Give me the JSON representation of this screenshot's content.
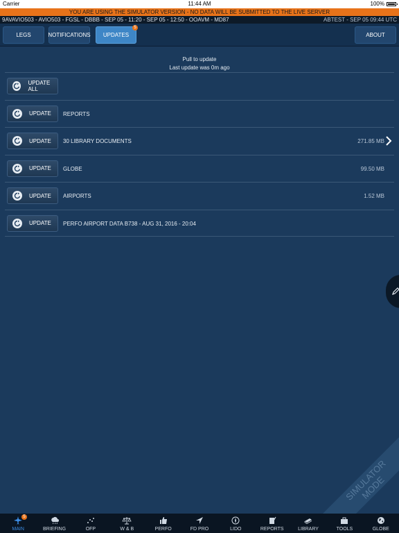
{
  "status_bar": {
    "carrier": "Carrier",
    "time": "11:44 AM",
    "battery": "100%"
  },
  "banner": "YOU ARE USING THE SIMULATOR VERSION - NO DATA WILL BE SUBMITTED TO THE LIVE SERVER",
  "flight_info": {
    "left": "9AVAVIO503 - AVIO503 - FGSL - DBBB - SEP 05 - 11:20 - SEP 05 - 12:50 - OOAVM - MD87",
    "right": "ABTEST - SEP 05 09:44 UTC"
  },
  "tabs": {
    "legs": "LEGS",
    "notifications": "NOTIFICATIONS",
    "updates": "UPDATES",
    "updates_badge": "5",
    "about": "ABOUT"
  },
  "pull": {
    "line1": "Pull to update",
    "line2": "Last update was 0m ago"
  },
  "update_all_label": "UPDATE ALL",
  "update_label": "UPDATE",
  "updates": [
    {
      "label": "REPORTS",
      "size": ""
    },
    {
      "label": "30 LIBRARY DOCUMENTS",
      "size": "271.85 MB"
    },
    {
      "label": "GLOBE",
      "size": "99.50 MB"
    },
    {
      "label": "AIRPORTS",
      "size": "1.52 MB"
    },
    {
      "label": "PERFO AIRPORT DATA B738 - AUG 31, 2016 - 20:04",
      "size": ""
    }
  ],
  "simulator_mode": {
    "line1": "SIMULATOR",
    "line2": "MODE"
  },
  "bottom_nav": {
    "main": "MAIN",
    "main_badge": "5",
    "briefing": "BRIEFING",
    "ofp": "OFP",
    "wb": "W & B",
    "perfo": "PERFO",
    "fdpro": "FD PRO",
    "lido": "LIDO",
    "reports": "REPORTS",
    "library": "LIBRARY",
    "tools": "TOOLS",
    "globe": "GLOBE"
  },
  "colors": {
    "accent": "#3e86c6",
    "banner": "#e8731a",
    "background": "#1b3a5c"
  }
}
